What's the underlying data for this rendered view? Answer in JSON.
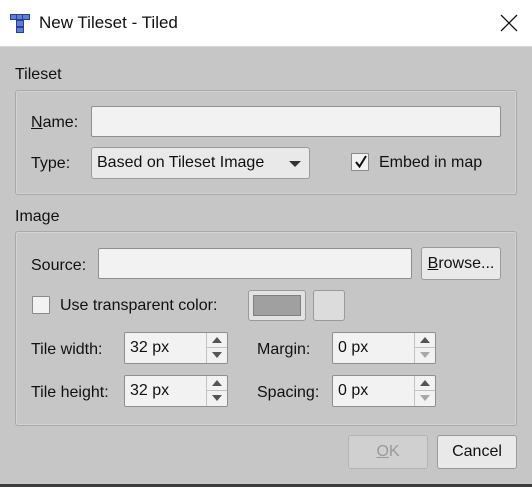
{
  "window": {
    "title": "New Tileset - Tiled",
    "icon": "tiled-app-icon",
    "close_icon": "close-icon"
  },
  "tileset_section": {
    "label": "Tileset",
    "name_label_first": "N",
    "name_label_rest": "ame:",
    "name_value": "",
    "type_label": "Type:",
    "type_value": "Based on Tileset Image",
    "embed_label": "Embed in map",
    "embed_checked": true
  },
  "image_section": {
    "label": "Image",
    "source_label": "Source:",
    "source_value": "",
    "browse_first": "B",
    "browse_rest": "rowse...",
    "transparent_label": "Use transparent color:",
    "transparent_checked": false,
    "transparent_color": "#a0a0a0",
    "tile_width_label": "Tile width:",
    "tile_width_value": "32 px",
    "tile_height_label": "Tile height:",
    "tile_height_value": "32 px",
    "margin_label": "Margin:",
    "margin_value": "0 px",
    "spacing_label": "Spacing:",
    "spacing_value": "0 px"
  },
  "buttons": {
    "ok_first": "O",
    "ok_rest": "K",
    "ok_enabled": false,
    "cancel": "Cancel"
  }
}
